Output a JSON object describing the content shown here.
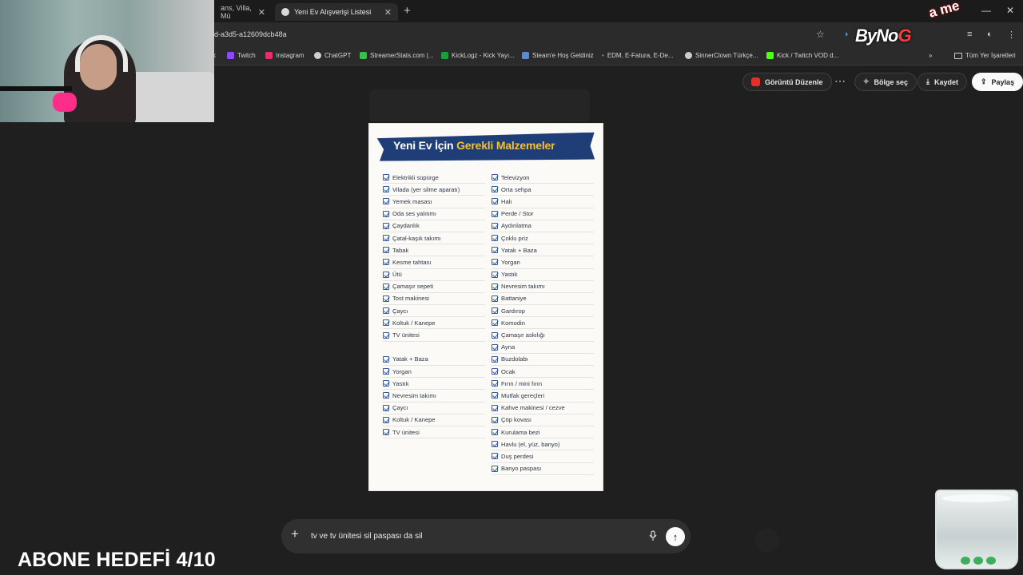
{
  "browser": {
    "tabs": [
      {
        "label": "ans, Villa, Mü",
        "active": false
      },
      {
        "label": "Yeni Ev Alışverişi Listesi",
        "active": true
      }
    ],
    "url": "d-a3d5-a12609dcb48a",
    "bookmarks": [
      {
        "label": "k",
        "color": "#444444"
      },
      {
        "label": "Twitch",
        "color": "#9146ff"
      },
      {
        "label": "Instagram",
        "color": "#e1306c"
      },
      {
        "label": "ChatGPT",
        "color": "#cfcfcf"
      },
      {
        "label": "StreamerStats.com |...",
        "color": "#3bbf4a"
      },
      {
        "label": "KickLogz - Kick Yayı...",
        "color": "#1e9e3a"
      },
      {
        "label": "Steam'e Hoş Geldiniz",
        "color": "#5a8ad6"
      },
      {
        "label": "EDM, E-Fatura, E-De...",
        "color": "#888888"
      },
      {
        "label": "SinnerClown Türkçe...",
        "color": "#cccccc"
      },
      {
        "label": "Kick / Twitch VOD d...",
        "color": "#53fc18"
      }
    ],
    "all_bookmarks": "Tüm Yer İşaretleri"
  },
  "brand": {
    "main_a": "ByNo",
    "main_b": "G",
    "extra": "a me"
  },
  "actions": {
    "edit_image": "Görüntü Düzenle",
    "select_region": "Bölge seç",
    "save": "Kaydet",
    "share": "Paylaş"
  },
  "document": {
    "title_a": "Yeni Ev İçin ",
    "title_b": "Gerekli Malzemeler",
    "left_items": [
      "Elektrikli süpürge",
      "Vilada (yer silme aparatı)",
      "Yemek masası",
      "Oda ses yalıtımı",
      "Çaydanlık",
      "Çatal-kaşık takımı",
      "Tabak",
      "Kesme tahtası",
      "Ütü",
      "Çamaşır sepeti",
      "Tost makinesi",
      "Çaycı",
      "Koltuk / Kanepe",
      "TV ünitesi"
    ],
    "left_items_2": [
      "Yatak + Baza",
      "Yorgan",
      "Yastık",
      "Nevresim takımı",
      "Çaycı",
      "Koltuk / Kanepe",
      "TV ünitesi"
    ],
    "right_items": [
      "Televizyon",
      "Orta sehpa",
      "Halı",
      "Perde / Stor",
      "Aydınlatma",
      "Çoklu priz",
      "Yatak + Baza",
      "Yorgan",
      "Yastık",
      "Nevresim takımı",
      "Battaniye",
      "Gardırop",
      "Komodin",
      "Çamaşır askılığı",
      "Ayna",
      "Buzdolabı",
      "Ocak",
      "Fırın / mini fırın",
      "Mutfak gereçleri",
      "Kahve makinesi / cezve",
      "Çöp kovası",
      "Kurulama bezi",
      "Havlu (el, yüz, banyo)",
      "Duş perdesi",
      "Banyo paspası"
    ]
  },
  "prompt": {
    "text": "tv ve tv ünitesi sil  paspası da sil"
  },
  "overlay": {
    "goal": "ABONE HEDEFİ 4/10"
  }
}
